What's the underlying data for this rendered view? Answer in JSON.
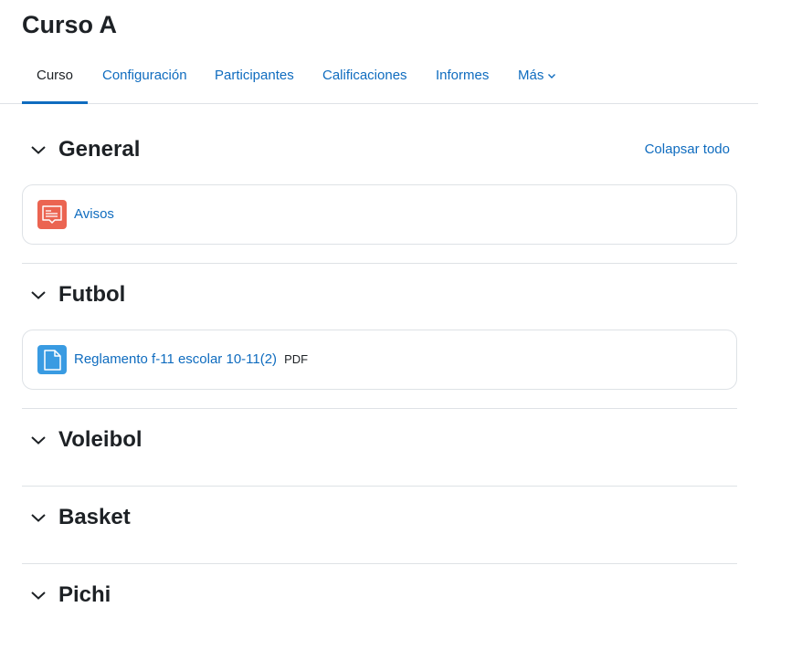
{
  "course": {
    "title": "Curso A"
  },
  "nav": {
    "tabs": [
      {
        "label": "Curso"
      },
      {
        "label": "Configuración"
      },
      {
        "label": "Participantes"
      },
      {
        "label": "Calificaciones"
      },
      {
        "label": "Informes"
      },
      {
        "label": "Más"
      }
    ]
  },
  "actions": {
    "collapse_all": "Colapsar todo"
  },
  "sections": [
    {
      "title": "General",
      "activities": [
        {
          "name": "Avisos",
          "icon": "forum-icon"
        }
      ]
    },
    {
      "title": "Futbol",
      "activities": [
        {
          "name": "Reglamento f-11 escolar 10-11(2)",
          "badge": "PDF",
          "icon": "file-icon"
        }
      ]
    },
    {
      "title": "Voleibol"
    },
    {
      "title": "Basket"
    },
    {
      "title": "Pichi"
    }
  ],
  "colors": {
    "link": "#0f6cbf",
    "forum": "#eb6451",
    "resource": "#399be2",
    "border": "#dee2e6"
  }
}
